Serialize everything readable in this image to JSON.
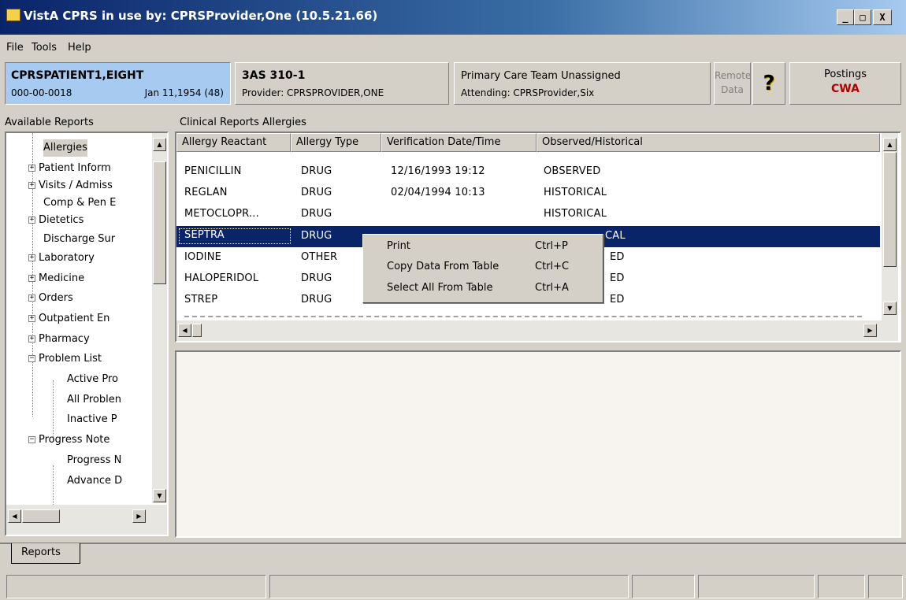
{
  "window": {
    "title": "VistA CPRS in use by: CPRSProvider,One  (10.5.21.66)",
    "minimize": "_",
    "maximize": "□",
    "close": "X"
  },
  "menu": [
    "File",
    "Tools",
    "Help"
  ],
  "patient": {
    "name": "CPRSPATIENT1,EIGHT",
    "ssn": "000-00-0018",
    "dob": "Jan 11,1954 (48)"
  },
  "location": {
    "ward": "3AS 310-1",
    "provider": "Provider: CPRSPROVIDER,ONE"
  },
  "care_team": {
    "team": "Primary Care Team Unassigned",
    "attending": "Attending: CPRSProvider,Six"
  },
  "remote_data": {
    "line1": "Remote",
    "line2": "Data"
  },
  "help_glyph": "?",
  "postings": {
    "label": "Postings",
    "value": "CWA"
  },
  "left_panel": {
    "label": "Available Reports",
    "tree": [
      {
        "label": "Allergies",
        "expander": ""
      },
      {
        "label": "Patient Inform",
        "expander": "+"
      },
      {
        "label": "Visits / Admiss",
        "expander": "+"
      },
      {
        "label": "Comp & Pen E",
        "expander": ""
      },
      {
        "label": "Dietetics",
        "expander": "+"
      },
      {
        "label": "Discharge Sur",
        "expander": ""
      },
      {
        "label": "Laboratory",
        "expander": "+"
      },
      {
        "label": "Medicine",
        "expander": "+"
      },
      {
        "label": "Orders",
        "expander": "+"
      },
      {
        "label": "Outpatient En",
        "expander": "+"
      },
      {
        "label": "Pharmacy",
        "expander": "+"
      },
      {
        "label": "Problem List",
        "expander": "−"
      },
      {
        "label": "Active Pro",
        "expander": ""
      },
      {
        "label": "All Problen",
        "expander": ""
      },
      {
        "label": "Inactive P",
        "expander": ""
      },
      {
        "label": "Progress Note",
        "expander": "−"
      },
      {
        "label": "Progress N",
        "expander": ""
      },
      {
        "label": "Advance D",
        "expander": ""
      }
    ]
  },
  "right_panel": {
    "label": "Clinical Reports Allergies",
    "columns": [
      "Allergy Reactant",
      "Allergy Type",
      "Verification Date/Time",
      "Observed/Historical"
    ],
    "rows": [
      [
        "PENICILLIN",
        "DRUG",
        "12/16/1993 19:12",
        "OBSERVED"
      ],
      [
        "REGLAN",
        "DRUG",
        "02/04/1994 10:13",
        "HISTORICAL"
      ],
      [
        "METOCLOPR...",
        "DRUG",
        "",
        "HISTORICAL"
      ],
      [
        "SEPTRA",
        "DRUG",
        "",
        "CAL"
      ],
      [
        "IODINE",
        "OTHER",
        "",
        "ED"
      ],
      [
        "HALOPERIDOL",
        "DRUG",
        "",
        "ED"
      ],
      [
        "STREP",
        "DRUG",
        "",
        "ED"
      ]
    ]
  },
  "context_menu": [
    {
      "label": "Print",
      "shortcut": "Ctrl+P"
    },
    {
      "label": "Copy Data From Table",
      "shortcut": "Ctrl+C"
    },
    {
      "label": "Select All From Table",
      "shortcut": "Ctrl+A"
    }
  ],
  "tabs": [
    "Reports"
  ],
  "colors": {
    "title_start": "#0a246a",
    "title_end": "#a6caf0",
    "patient_box": "#a6caf0",
    "selection": "#0a246a",
    "posting_cwa": "#b00000"
  }
}
